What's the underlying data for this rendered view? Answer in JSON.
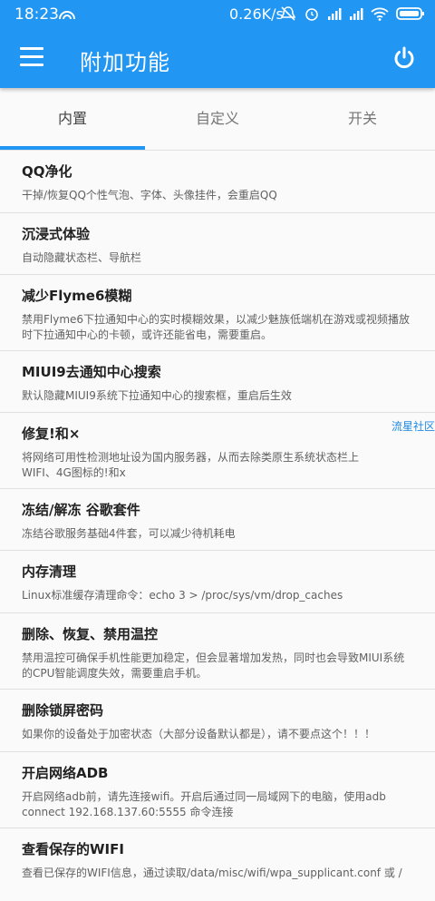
{
  "status_bar": {
    "time": "18:23",
    "speed": "0.26K/s"
  },
  "toolbar": {
    "title": "附加功能"
  },
  "tabs": [
    {
      "label": "内置",
      "selected": true
    },
    {
      "label": "自定义",
      "selected": false
    },
    {
      "label": "开关",
      "selected": false
    }
  ],
  "items": [
    {
      "title": "QQ净化",
      "desc": "干掉/恢复QQ个性气泡、字体、头像挂件，会重启QQ"
    },
    {
      "title": "沉浸式体验",
      "desc": "自动隐藏状态栏、导航栏"
    },
    {
      "title": "减少Flyme6模糊",
      "desc": "禁用Flyme6下拉通知中心的实时模糊效果，以减少魅族低端机在游戏或视频播放时下拉通知中心的卡顿，或许还能省电，需要重启。"
    },
    {
      "title": "MIUI9去通知中心搜索",
      "desc": "默认隐藏MIUI9系统下拉通知中心的搜索框，重启后生效"
    },
    {
      "title": "修复!和×",
      "desc": "将网络可用性检测地址设为国内服务器，从而去除类原生系统状态栏上WIFI、4G图标的!和x",
      "side_label": "流星社区"
    },
    {
      "title": "冻结/解冻 谷歌套件",
      "desc": "冻结谷歌服务基础4件套，可以减少待机耗电"
    },
    {
      "title": "内存清理",
      "desc": "Linux标准缓存清理命令：echo 3 > /proc/sys/vm/drop_caches"
    },
    {
      "title": "删除、恢复、禁用温控",
      "desc": "禁用温控可确保手机性能更加稳定，但会显著增加发热，同时也会导致MIUI系统的CPU智能调度失效，需要重启手机。"
    },
    {
      "title": "删除锁屏密码",
      "desc": "如果你的设备处于加密状态（大部分设备默认都是），请不要点这个！！！"
    },
    {
      "title": "开启网络ADB",
      "desc": "开启网络adb前，请先连接wifi。开启后通过同一局域网下的电脑，使用adb connect 192.168.137.60:5555 命令连接"
    },
    {
      "title": "查看保存的WIFI",
      "desc": "查看已保存的WIFI信息，通过读取/data/misc/wifi/wpa_supplicant.conf 或 /"
    }
  ]
}
